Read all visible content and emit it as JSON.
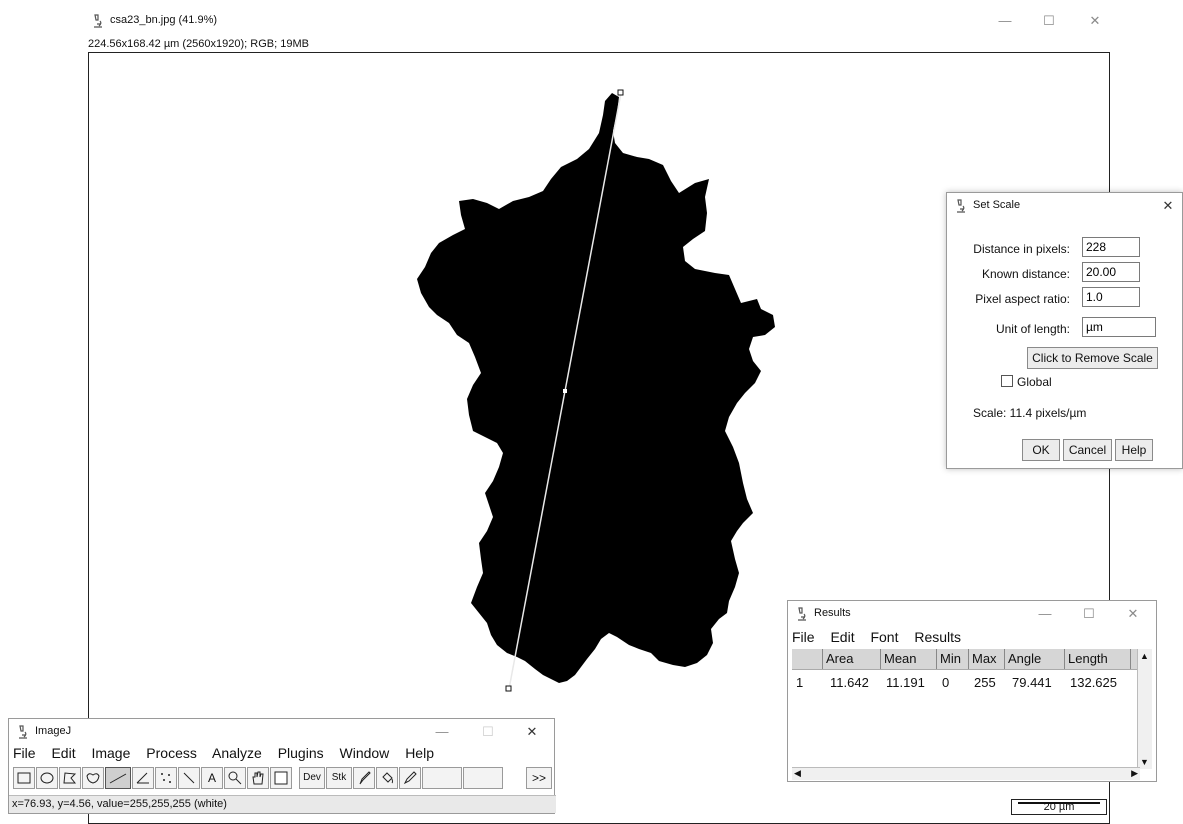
{
  "main_window": {
    "title": "csa23_bn.jpg (41.9%)",
    "info": "224.56x168.42 µm (2560x1920); RGB; 19MB",
    "scale_bar_label": "20 µm"
  },
  "set_scale": {
    "title": "Set Scale",
    "distance_label": "Distance in pixels:",
    "distance_value": "228",
    "known_label": "Known distance:",
    "known_value": "20.00",
    "aspect_label": "Pixel aspect ratio:",
    "aspect_value": "1.0",
    "unit_label": "Unit of length:",
    "unit_value": "µm",
    "remove_scale": "Click to Remove Scale",
    "global_label": "Global",
    "global_checked": false,
    "scale_text": "Scale: 11.4 pixels/µm",
    "ok": "OK",
    "cancel": "Cancel",
    "help": "Help"
  },
  "results": {
    "title": "Results",
    "menu": [
      "File",
      "Edit",
      "Font",
      "Results"
    ],
    "columns": [
      "",
      "Area",
      "Mean",
      "Min",
      "Max",
      "Angle",
      "Length"
    ],
    "rows": [
      [
        "1",
        "11.642",
        "11.191",
        "0",
        "255",
        "79.441",
        "132.625"
      ]
    ]
  },
  "imagej": {
    "title": "ImageJ",
    "menu": [
      "File",
      "Edit",
      "Image",
      "Process",
      "Analyze",
      "Plugins",
      "Window",
      "Help"
    ],
    "tools": [
      "rectangle-tool",
      "oval-tool",
      "polygon-tool",
      "freehand-tool",
      "straight-line-tool",
      "angle-tool",
      "multi-point-tool",
      "wand-tool",
      "text-tool",
      "magnifier-tool",
      "hand-tool",
      "color-picker-tool",
      "dev-menu",
      "stk-menu",
      "brush-tool",
      "flood-fill-tool",
      "pencil-tool",
      "blank-slot-1",
      "blank-slot-2",
      "more-tools"
    ],
    "dev_label": "Dev",
    "stk_label": "Stk",
    "text_tool_label": "A",
    "more_label": ">>",
    "status": "x=76.93, y=4.56, value=255,255,255 (white)"
  }
}
